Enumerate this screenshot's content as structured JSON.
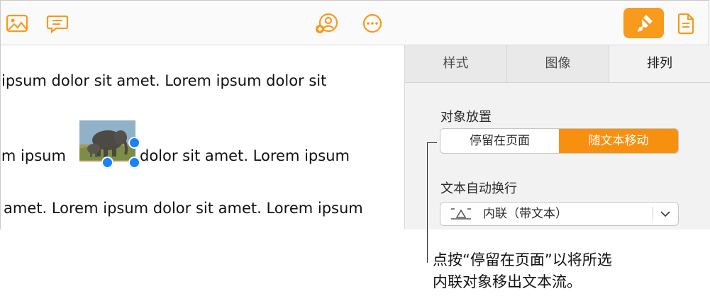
{
  "toolbar": {
    "icons": [
      "media-icon",
      "comment-icon",
      "collaborate-icon",
      "more-icon",
      "format-icon",
      "document-icon"
    ],
    "accent_color": "#f89a1c"
  },
  "document": {
    "line1": "ipsum dolor sit amet.  Lorem ipsum dolor sit",
    "line2_before": "em ipsum",
    "line2_after": "dolor sit amet. Lorem ipsum",
    "line3": "amet. Lorem ipsum dolor sit amet. Lorem ipsum"
  },
  "inspector": {
    "tabs": [
      {
        "label": "样式",
        "selected": false
      },
      {
        "label": "图像",
        "selected": false
      },
      {
        "label": "排列",
        "selected": true
      }
    ],
    "object_placement": {
      "label": "对象放置",
      "options": [
        "停留在页面",
        "随文本移动"
      ],
      "selected": "随文本移动"
    },
    "text_wrap": {
      "label": "文本自动换行",
      "value": "内联（带文本）"
    }
  },
  "callout": {
    "line1": "点按“停留在页面”以将所选",
    "line2": "内联对象移出文本流。"
  }
}
